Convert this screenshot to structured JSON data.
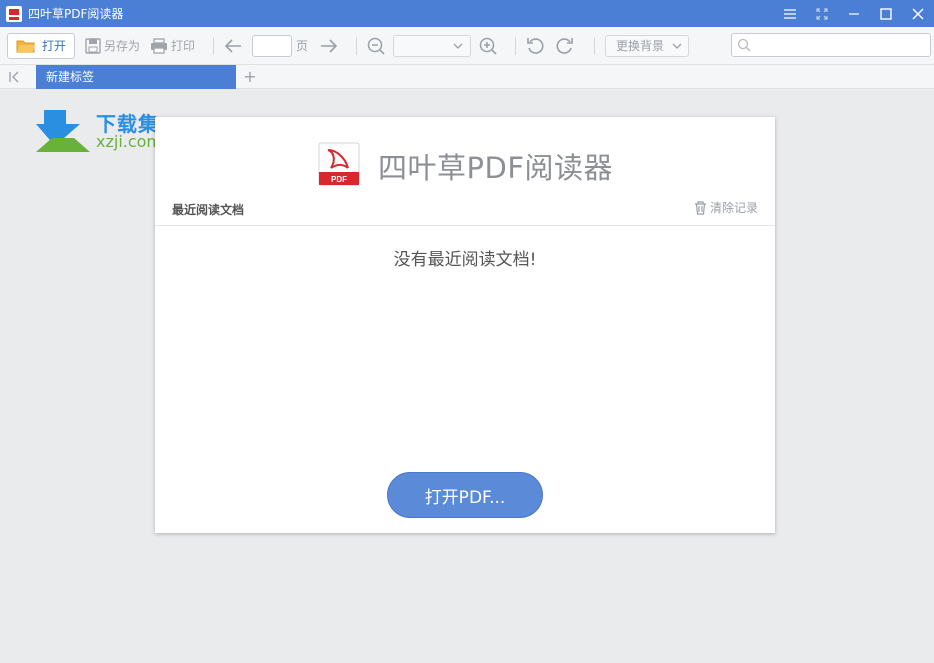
{
  "window": {
    "title": "四叶草PDF阅读器"
  },
  "toolbar": {
    "open_label": "打开",
    "save_as_label": "另存为",
    "print_label": "打印",
    "page_value": "",
    "page_label": "页",
    "zoom_value": "",
    "background_label": "更换背景",
    "search_value": ""
  },
  "tabs": [
    {
      "label": "新建标签",
      "active": true
    }
  ],
  "watermark": {
    "line1": "下载集",
    "line2": "xzji.com"
  },
  "panel": {
    "title": "四叶草PDF阅读器",
    "logo_text": "PDF",
    "recent_label": "最近阅读文档",
    "clear_label": "清除记录",
    "empty_message": "没有最近阅读文档!",
    "open_button_label": "打开PDF..."
  },
  "colors": {
    "accent": "#4a7fd5",
    "button": "#5b8ad8",
    "pdf_red": "#d8282d"
  }
}
